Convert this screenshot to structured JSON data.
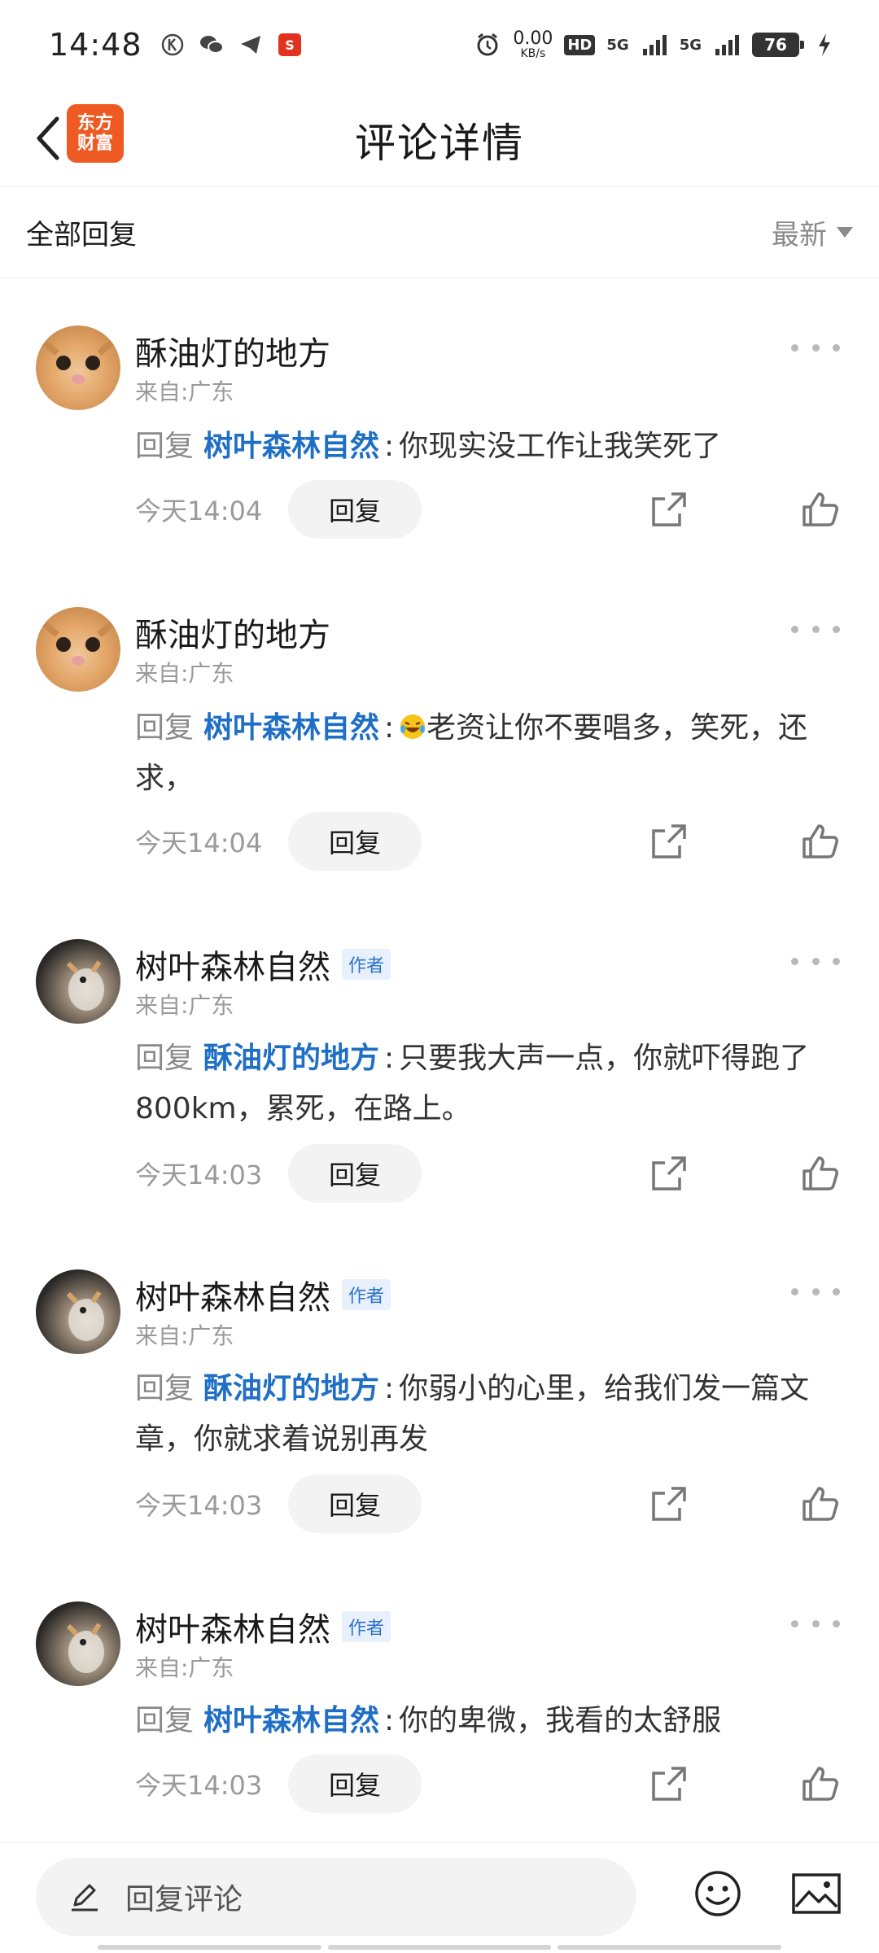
{
  "status_bar": {
    "time": "14:48",
    "net_speed_value": "0.00",
    "net_speed_unit": "KB/s",
    "hd_label": "HD",
    "signal_1": "5G",
    "signal_2": "5G",
    "battery": "76"
  },
  "header": {
    "logo_line1": "东方",
    "logo_line2": "财富",
    "title": "评论详情"
  },
  "filter": {
    "label": "全部回复",
    "sort": "最新"
  },
  "comments": [
    {
      "name": "酥油灯的地方",
      "author_badge": "",
      "location": "来自:广东",
      "reply_prefix": "回复",
      "reply_target": "树叶森林自然",
      "text": "你现实没工作让我笑死了",
      "time": "今天14:04",
      "reply_label": "回复"
    },
    {
      "name": "酥油灯的地方",
      "author_badge": "",
      "location": "来自:广东",
      "reply_prefix": "回复",
      "reply_target": "树叶森林自然",
      "text": "老资让你不要唱多，笑死，还求，",
      "time": "今天14:04",
      "reply_label": "回复"
    },
    {
      "name": "树叶森林自然",
      "author_badge": "作者",
      "location": "来自:广东",
      "reply_prefix": "回复",
      "reply_target": "酥油灯的地方",
      "text": "只要我大声一点，你就吓得跑了800km，累死，在路上。",
      "time": "今天14:03",
      "reply_label": "回复"
    },
    {
      "name": "树叶森林自然",
      "author_badge": "作者",
      "location": "来自:广东",
      "reply_prefix": "回复",
      "reply_target": "酥油灯的地方",
      "text": "你弱小的心里，给我们发一篇文章，你就求着说别再发",
      "time": "今天14:03",
      "reply_label": "回复"
    },
    {
      "name": "树叶森林自然",
      "author_badge": "作者",
      "location": "来自:广东",
      "reply_prefix": "回复",
      "reply_target": "树叶森林自然",
      "text": "你的卑微，我看的太舒服",
      "time": "今天14:03",
      "reply_label": "回复"
    }
  ],
  "bottom_bar": {
    "placeholder": "回复评论"
  },
  "colors": {
    "link_blue": "#1f6fc6",
    "logo_orange": "#ef5a22",
    "muted_gray": "#9a9a9a"
  }
}
